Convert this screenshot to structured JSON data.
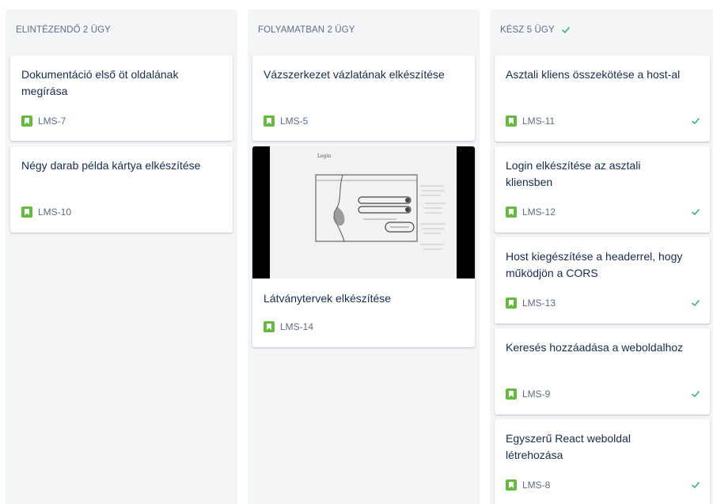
{
  "columns": [
    {
      "header": "ELINTÉZENDŐ 2 ÜGY",
      "cards": [
        {
          "title": "Dokumentáció első öt oldalának megírása",
          "key": "LMS-7"
        },
        {
          "title": "Négy darab példa kártya elkészítése",
          "key": "LMS-10"
        }
      ]
    },
    {
      "header": "FOLYAMATBAN 2 ÜGY",
      "cards": [
        {
          "title": "Vázszerkezet vázlatának elkészítése",
          "key": "LMS-5"
        },
        {
          "title": "Látványtervek elkészítése",
          "key": "LMS-14",
          "sketch_text": "Login"
        }
      ]
    },
    {
      "header": "KÉSZ 5 ÜGY",
      "cards": [
        {
          "title": "Asztali kliens összekötése a host-al",
          "key": "LMS-11"
        },
        {
          "title": "Login elkészítése az asztali kliensben",
          "key": "LMS-12"
        },
        {
          "title": "Host kiegészítése a headerrel, hogy működjön a CORS",
          "key": "LMS-13"
        },
        {
          "title": "Keresés hozzáadása a weboldalhoz",
          "key": "LMS-9"
        },
        {
          "title": "Egyszerű React weboldal létrehozása",
          "key": "LMS-8"
        }
      ]
    }
  ],
  "icons": {
    "story": "bookmark-icon",
    "done": "check-icon"
  },
  "colors": {
    "story_green": "#63ba3c",
    "done_check": "#36b37e",
    "column_bg": "#f4f5f7",
    "muted_text": "#5e6c84"
  }
}
